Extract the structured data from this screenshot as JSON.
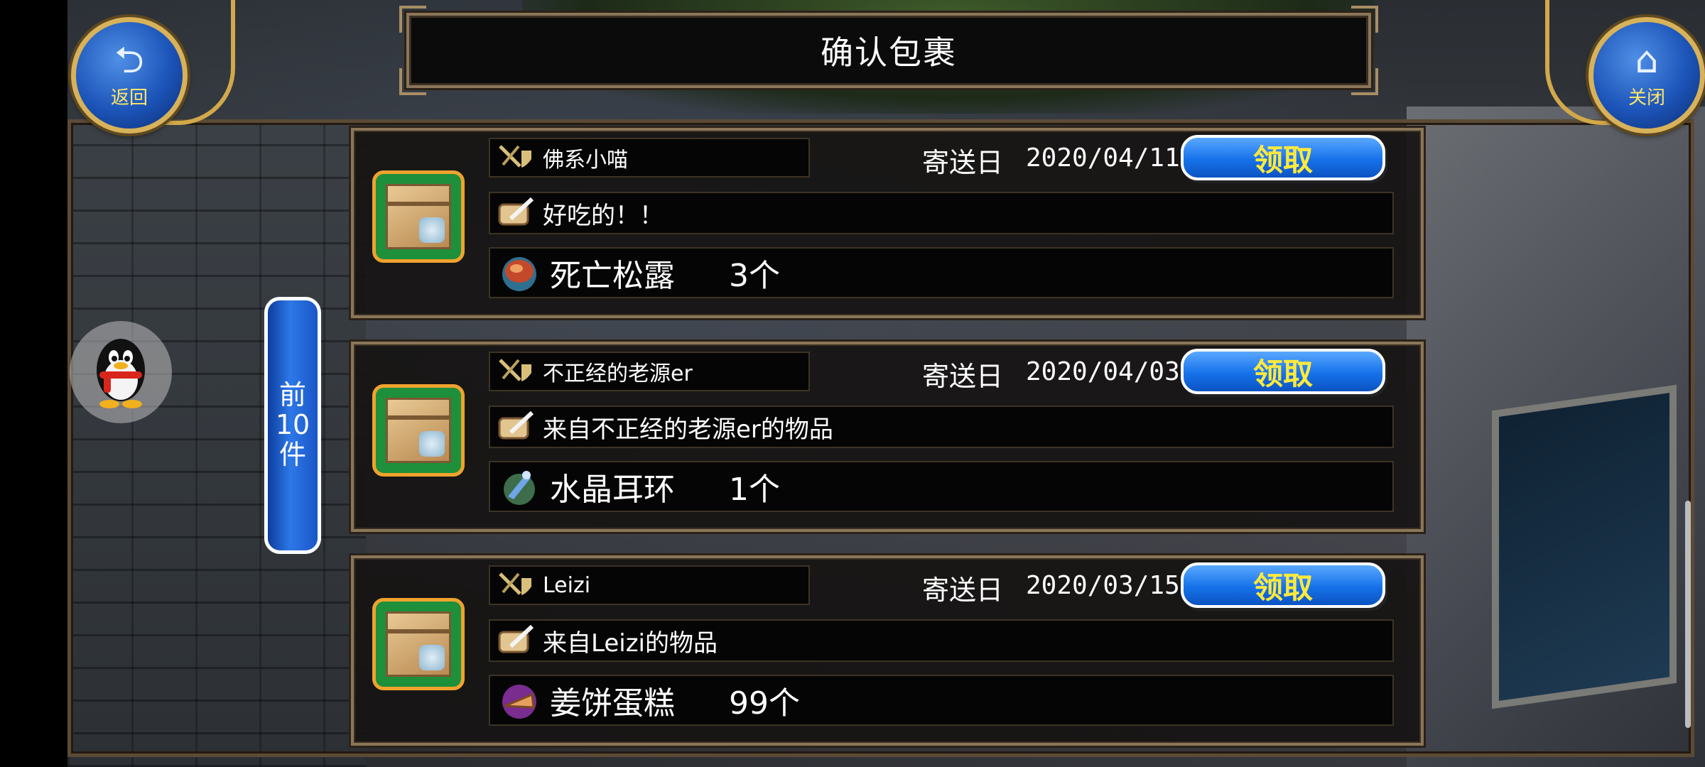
{
  "header": {
    "title": "确认包裹",
    "back_label": "返回",
    "close_label": "关闭"
  },
  "side": {
    "prev_button": [
      "前",
      "10",
      "件"
    ]
  },
  "packages": [
    {
      "sender": "佛系小喵",
      "date_label": "寄送日",
      "date": "2020/04/11",
      "claim_label": "领取",
      "message": "好吃的！！",
      "item_name": "死亡松露",
      "item_qty": "3个",
      "item_icon": "meat-icon"
    },
    {
      "sender": "不正经的老源er",
      "date_label": "寄送日",
      "date": "2020/04/03",
      "claim_label": "领取",
      "message": "来自不正经的老源er的物品",
      "item_name": "水晶耳环",
      "item_qty": "1个",
      "item_icon": "earring-icon"
    },
    {
      "sender": "Leizi",
      "date_label": "寄送日",
      "date": "2020/03/15",
      "claim_label": "领取",
      "message": "来自Leizi的物品",
      "item_name": "姜饼蛋糕",
      "item_qty": "99个",
      "item_icon": "cake-icon"
    }
  ],
  "colors": {
    "frame": "#8b7659",
    "claim_text": "#ffe93c",
    "button_blue": "#1672ea",
    "package_icon_bg": "#1e8f3a"
  }
}
